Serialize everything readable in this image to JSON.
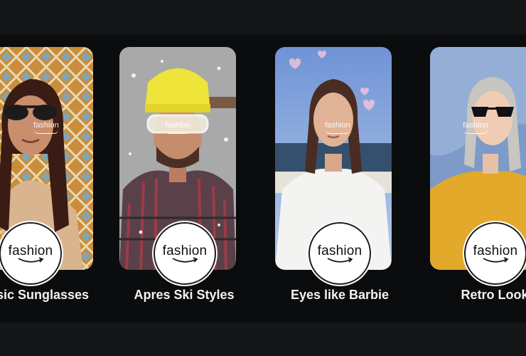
{
  "filters": [
    {
      "label": "sic Sunglasses",
      "watermark": "fashion",
      "badge_text": "fashion",
      "accent": "#c98d3b"
    },
    {
      "label": "Apres Ski Styles",
      "watermark": "fashion",
      "badge_text": "fashion",
      "accent": "#efe43a"
    },
    {
      "label": "Eyes like Barbie",
      "watermark": "fashion",
      "badge_text": "fashion",
      "accent": "#8fb3e8"
    },
    {
      "label": "Retro Look",
      "watermark": "fashion",
      "badge_text": "fashion",
      "accent": "#e2a92a"
    }
  ],
  "colors": {
    "background": "#151617",
    "band": "#0b0c0d",
    "label_text": "#f2f2f2",
    "badge_bg": "#ffffff"
  },
  "icons": [
    "amazon-smile-logo",
    "snowflake-decoration",
    "heart-decoration"
  ]
}
